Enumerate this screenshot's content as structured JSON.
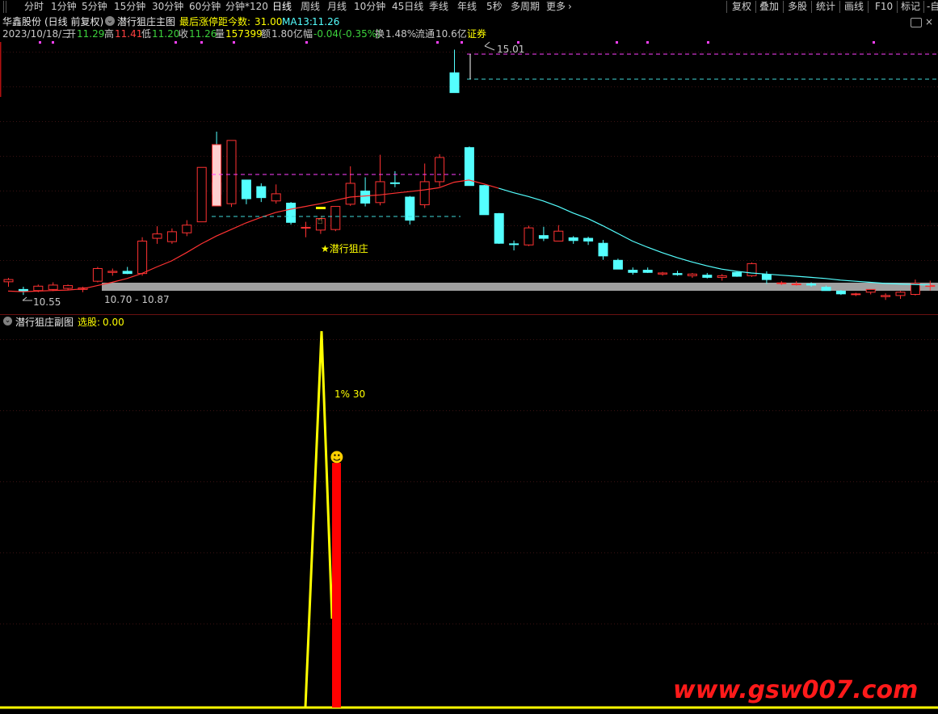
{
  "toolbar": {
    "items": [
      "分时",
      "1分钟",
      "5分钟",
      "15分钟",
      "30分钟",
      "60分钟",
      "分钟*120",
      "日线",
      "周线",
      "月线",
      "10分钟",
      "45日线",
      "季线",
      "年线",
      "5秒",
      "多周期",
      "更多"
    ],
    "active": "日线",
    "more_chevron": "chevron-right-icon",
    "right_items": [
      "复权",
      "叠加",
      "多股",
      "统计",
      "画线",
      "F10",
      "标记",
      "-自"
    ]
  },
  "main_panel": {
    "stock_name": "华鑫股份",
    "period_note": "(日线 前复权)",
    "formula_name": "潜行狙庄主图",
    "limit_label": "最后涨停距今数:",
    "limit_value": "31.00",
    "ma_label": "MA13:",
    "ma_value": "11.26",
    "date": "2023/10/18/三",
    "open_label": "开",
    "open": "11.29",
    "high_label": "高",
    "high": "11.41",
    "low_label": "低",
    "low": "11.20",
    "close_label": "收",
    "close": "11.26",
    "vol_label": "量",
    "vol": "157399",
    "amount_label": "额",
    "amount": "1.80亿",
    "change_label": "幅",
    "change": "-0.04(-0.35%)",
    "turnover_label": "换",
    "turnover": "1.48%",
    "float_label": "流通",
    "float": "10.6亿",
    "sector": "证券",
    "high_marker": "15.01",
    "low_marker": "10.55",
    "band_label": "10.70 - 10.87",
    "signal_label": "★潜行狙庄"
  },
  "sub_panel": {
    "title": "潜行狙庄副图",
    "select_label": "选股:",
    "select_value": "0.00",
    "peak_label": "1% 30",
    "smiley": "☻"
  },
  "watermark": "www.gsw007.com",
  "colors": {
    "up": "#ff3232",
    "down": "#54ffff",
    "ma": "#ff3232",
    "ma2": "#54ffff",
    "yellow": "#ffff00",
    "magenta": "#ff40ff",
    "cyan_dash": "#3fd8d8",
    "band_gray": "#a0a0a0",
    "watermark": "#ff1a1a"
  },
  "chart_data": {
    "type": "candlestick",
    "candles": [
      {
        "o": 10.79,
        "h": 10.86,
        "l": 10.7,
        "c": 10.83
      },
      {
        "o": 10.65,
        "h": 10.7,
        "l": 10.55,
        "c": 10.62
      },
      {
        "o": 10.63,
        "h": 10.74,
        "l": 10.6,
        "c": 10.71
      },
      {
        "o": 10.65,
        "h": 10.78,
        "l": 10.62,
        "c": 10.73
      },
      {
        "o": 10.67,
        "h": 10.74,
        "l": 10.64,
        "c": 10.72
      },
      {
        "o": 10.65,
        "h": 10.7,
        "l": 10.6,
        "c": 10.68
      },
      {
        "o": 10.8,
        "h": 11.06,
        "l": 10.78,
        "c": 11.03
      },
      {
        "o": 10.96,
        "h": 11.03,
        "l": 10.9,
        "c": 10.98
      },
      {
        "o": 10.98,
        "h": 11.06,
        "l": 10.93,
        "c": 10.94
      },
      {
        "o": 10.94,
        "h": 11.6,
        "l": 10.9,
        "c": 11.53
      },
      {
        "o": 11.58,
        "h": 11.8,
        "l": 11.48,
        "c": 11.66
      },
      {
        "o": 11.52,
        "h": 11.76,
        "l": 11.48,
        "c": 11.7
      },
      {
        "o": 11.68,
        "h": 11.91,
        "l": 11.62,
        "c": 11.82
      },
      {
        "o": 11.88,
        "h": 12.87,
        "l": 11.88,
        "c": 12.87
      },
      {
        "o": 12.59,
        "h": 13.52,
        "l": 12.45,
        "c": 12.38
      },
      {
        "o": 12.21,
        "h": 13.36,
        "l": 12.15,
        "c": 13.36
      },
      {
        "o": 12.64,
        "h": 12.64,
        "l": 12.2,
        "c": 12.3
      },
      {
        "o": 12.52,
        "h": 12.58,
        "l": 12.24,
        "c": 12.32
      },
      {
        "o": 12.26,
        "h": 12.56,
        "l": 12.21,
        "c": 12.39
      },
      {
        "o": 12.22,
        "h": 12.24,
        "l": 11.83,
        "c": 11.87
      },
      {
        "o": 11.78,
        "h": 11.88,
        "l": 11.6,
        "c": 11.78
      },
      {
        "o": 11.73,
        "h": 11.95,
        "l": 11.66,
        "c": 11.94
      },
      {
        "o": 11.74,
        "h": 12.16,
        "l": 11.71,
        "c": 12.16
      },
      {
        "o": 12.2,
        "h": 12.89,
        "l": 12.17,
        "c": 12.58
      },
      {
        "o": 12.44,
        "h": 12.69,
        "l": 12.16,
        "c": 12.22
      },
      {
        "o": 12.23,
        "h": 13.1,
        "l": 12.18,
        "c": 12.61
      },
      {
        "o": 12.59,
        "h": 12.8,
        "l": 12.51,
        "c": 12.58
      },
      {
        "o": 12.33,
        "h": 12.35,
        "l": 11.83,
        "c": 11.91
      },
      {
        "o": 12.19,
        "h": 12.94,
        "l": 12.13,
        "c": 12.61
      },
      {
        "o": 12.61,
        "h": 13.11,
        "l": 12.52,
        "c": 13.05
      },
      {
        "o": 14.59,
        "h": 15.01,
        "l": 14.4,
        "c": 14.23
      },
      {
        "o": 13.23,
        "h": 13.25,
        "l": 12.99,
        "c": 12.54
      },
      {
        "o": 12.54,
        "h": 12.55,
        "l": 12.05,
        "c": 12.01
      },
      {
        "o": 12.03,
        "h": 12.04,
        "l": 11.48,
        "c": 11.49
      },
      {
        "o": 11.48,
        "h": 11.54,
        "l": 11.36,
        "c": 11.47
      },
      {
        "o": 11.46,
        "h": 11.81,
        "l": 11.44,
        "c": 11.77
      },
      {
        "o": 11.63,
        "h": 11.79,
        "l": 11.53,
        "c": 11.58
      },
      {
        "o": 11.53,
        "h": 11.82,
        "l": 11.66,
        "c": 11.71
      },
      {
        "o": 11.59,
        "h": 11.62,
        "l": 11.48,
        "c": 11.54
      },
      {
        "o": 11.58,
        "h": 11.61,
        "l": 11.46,
        "c": 11.53
      },
      {
        "o": 11.49,
        "h": 11.55,
        "l": 11.19,
        "c": 11.26
      },
      {
        "o": 11.18,
        "h": 11.21,
        "l": 11.07,
        "c": 11.02
      },
      {
        "o": 11.0,
        "h": 11.05,
        "l": 10.92,
        "c": 10.96
      },
      {
        "o": 11.0,
        "h": 11.05,
        "l": 10.95,
        "c": 10.96
      },
      {
        "o": 10.93,
        "h": 10.97,
        "l": 10.9,
        "c": 10.95
      },
      {
        "o": 10.94,
        "h": 10.99,
        "l": 10.9,
        "c": 10.92
      },
      {
        "o": 10.9,
        "h": 10.95,
        "l": 10.86,
        "c": 10.93
      },
      {
        "o": 10.91,
        "h": 10.95,
        "l": 10.85,
        "c": 10.87
      },
      {
        "o": 10.87,
        "h": 10.93,
        "l": 10.81,
        "c": 10.9
      },
      {
        "o": 10.96,
        "h": 10.97,
        "l": 10.88,
        "c": 10.89
      },
      {
        "o": 10.9,
        "h": 11.14,
        "l": 10.88,
        "c": 11.12
      },
      {
        "o": 10.92,
        "h": 10.98,
        "l": 10.75,
        "c": 10.83
      },
      {
        "o": 10.77,
        "h": 10.8,
        "l": 10.73,
        "c": 10.77
      },
      {
        "o": 10.75,
        "h": 10.8,
        "l": 10.72,
        "c": 10.75
      },
      {
        "o": 10.75,
        "h": 10.78,
        "l": 10.7,
        "c": 10.73
      },
      {
        "o": 10.69,
        "h": 10.72,
        "l": 10.63,
        "c": 10.63
      },
      {
        "o": 10.62,
        "h": 10.64,
        "l": 10.55,
        "c": 10.57
      },
      {
        "o": 10.57,
        "h": 10.59,
        "l": 10.53,
        "c": 10.57
      },
      {
        "o": 10.6,
        "h": 10.65,
        "l": 10.56,
        "c": 10.65
      },
      {
        "o": 10.52,
        "h": 10.58,
        "l": 10.46,
        "c": 10.54
      },
      {
        "o": 10.54,
        "h": 10.62,
        "l": 10.48,
        "c": 10.6
      },
      {
        "o": 10.56,
        "h": 10.83,
        "l": 10.54,
        "c": 10.76
      },
      {
        "o": 10.72,
        "h": 10.81,
        "l": 10.63,
        "c": 10.72
      }
    ],
    "ma": [
      10.62,
      10.61,
      10.62,
      10.63,
      10.64,
      10.66,
      10.72,
      10.78,
      10.85,
      10.94,
      11.06,
      11.17,
      11.32,
      11.48,
      11.62,
      11.74,
      11.86,
      11.96,
      12.05,
      12.11,
      12.16,
      12.21,
      12.27,
      12.33,
      12.35,
      12.37,
      12.4,
      12.43,
      12.46,
      12.5,
      12.6,
      12.64,
      12.57,
      12.49,
      12.41,
      12.34,
      12.26,
      12.16,
      12.04,
      11.94,
      11.81,
      11.67,
      11.53,
      11.42,
      11.32,
      11.23,
      11.15,
      11.08,
      11.02,
      10.98,
      10.95,
      10.93,
      10.91,
      10.89,
      10.87,
      10.85,
      10.82,
      10.8,
      10.78,
      10.76,
      10.75,
      10.74,
      10.73
    ],
    "ma13_last": 11.26,
    "y_range": [
      10.45,
      15.15
    ],
    "sub_series": {
      "name": "选股",
      "peak": 1.0,
      "signal_bar": 0.65
    }
  }
}
